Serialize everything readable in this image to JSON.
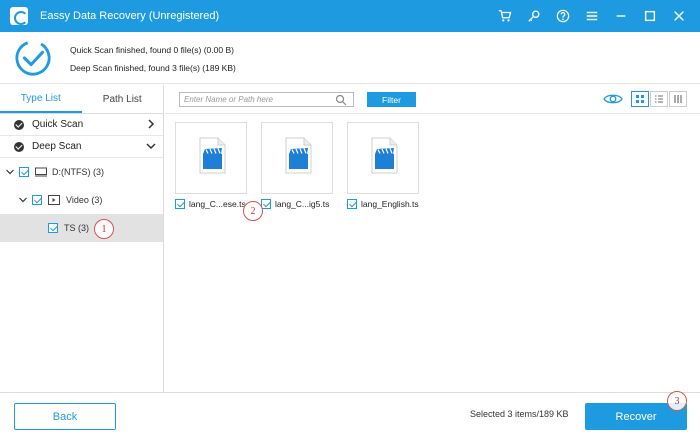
{
  "app": {
    "title": "Eassy Data Recovery (Unregistered)"
  },
  "status": {
    "quick": "Quick Scan finished, found 0 file(s) (0.00  B)",
    "deep": "Deep Scan finished, found 3 file(s) (189 KB)"
  },
  "tabs": [
    {
      "label": "Type List"
    },
    {
      "label": "Path List"
    }
  ],
  "scans": [
    {
      "label": "Quick Scan"
    },
    {
      "label": "Deep Scan"
    }
  ],
  "tree": {
    "drive": "D:(NTFS) (3)",
    "video": "Video (3)",
    "ts": "TS (3)"
  },
  "search": {
    "placeholder": "Enter Name or Path here"
  },
  "filter_label": "Filter",
  "files": [
    {
      "name": "lang_C...ese.ts"
    },
    {
      "name": "lang_C...ig5.ts"
    },
    {
      "name": "lang_English.ts"
    }
  ],
  "badges": {
    "one": "1",
    "two": "2",
    "three": "3"
  },
  "footer": {
    "back_label": "Back",
    "selected": "Selected 3 items/189 KB",
    "recover_label": "Recover"
  },
  "colors": {
    "accent": "#1e9be0",
    "badge": "#d9534f"
  }
}
